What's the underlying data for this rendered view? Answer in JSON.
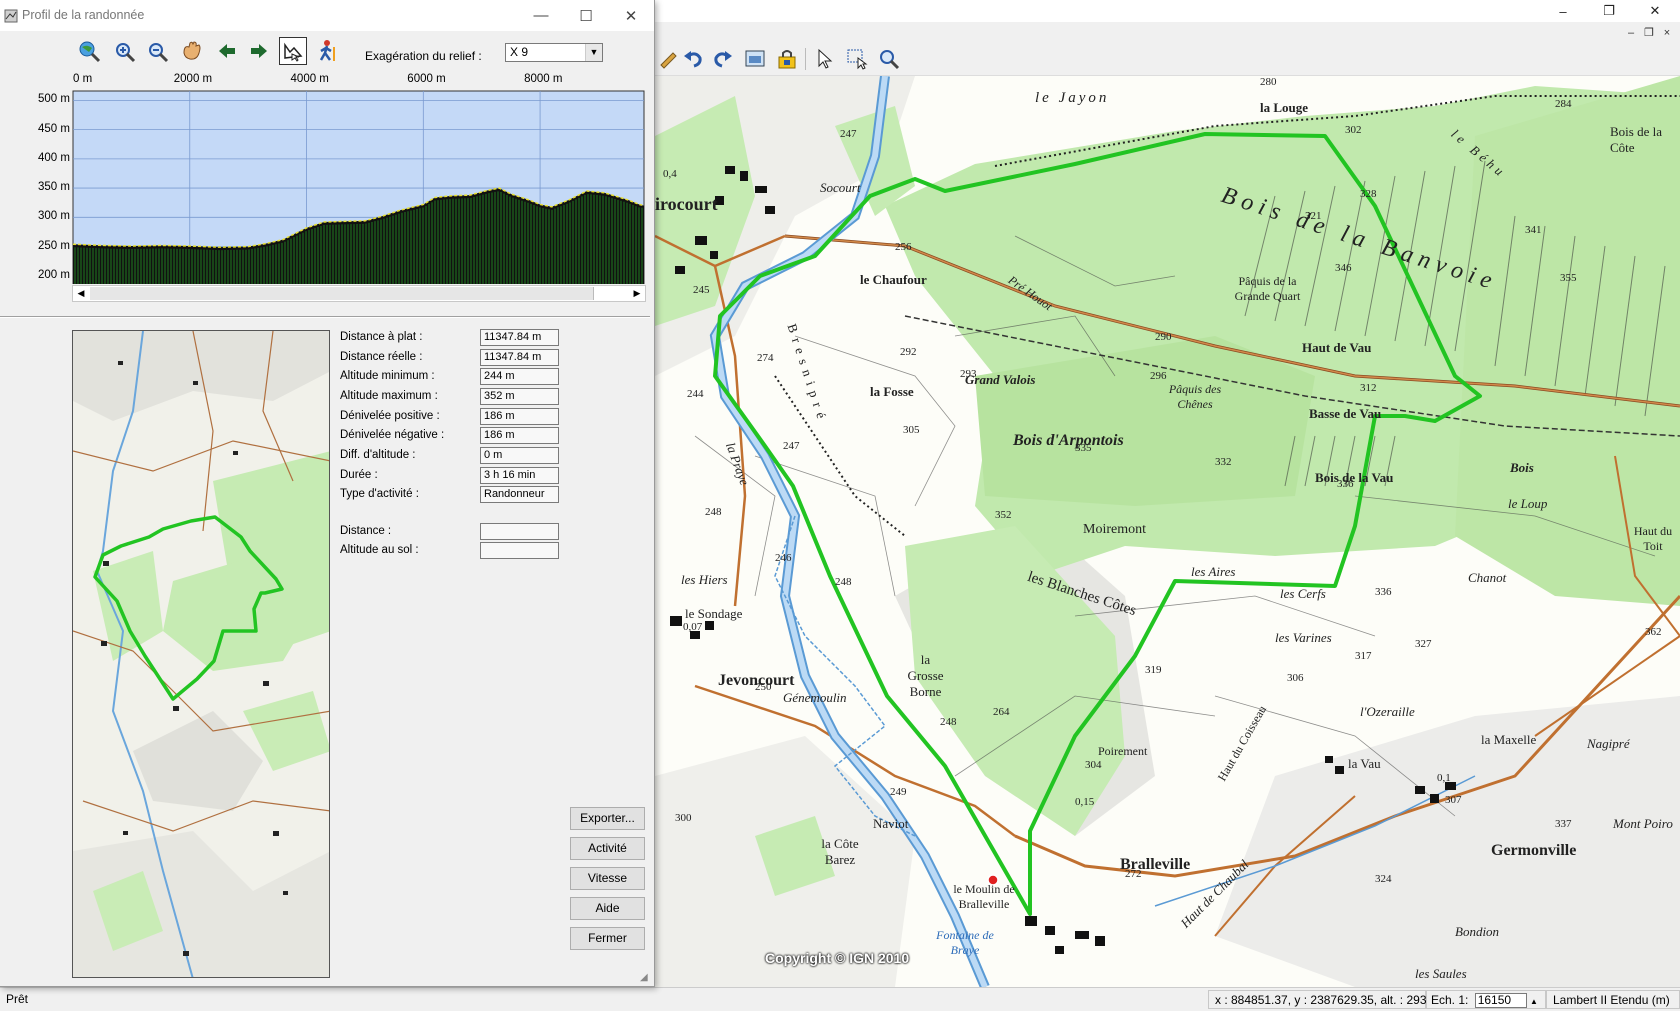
{
  "app": {
    "window_controls": {
      "minimize": "–",
      "restore": "❐",
      "close": "✕"
    },
    "mdi_controls": {
      "minimize": "–",
      "restore": "❐",
      "close": "×"
    }
  },
  "dialog": {
    "title": "Profil de la randonnée",
    "controls": {
      "minimize": "—",
      "maximize": "☐",
      "close": "✕"
    },
    "toolbar_icons": [
      "zoom-globe-icon",
      "zoom-in-icon",
      "zoom-out-icon",
      "pan-hand-icon",
      "arrow-left-icon",
      "arrow-right-icon",
      "profile-view-icon",
      "hiker-icon"
    ],
    "relief_label": "Exagération du relief :",
    "relief_value": "X 9",
    "profile": {
      "x_ticks": [
        "0 m",
        "2000 m",
        "4000 m",
        "6000 m",
        "8000 m"
      ],
      "y_ticks": [
        "500 m",
        "450 m",
        "400 m",
        "350 m",
        "300 m",
        "250 m",
        "200 m"
      ],
      "sky_color": "#c4d9f7",
      "terrain_color": "#1e7a1e",
      "elevation_points": [
        [
          0,
          254
        ],
        [
          500,
          252
        ],
        [
          1000,
          251
        ],
        [
          1500,
          252
        ],
        [
          2000,
          251
        ],
        [
          2500,
          249
        ],
        [
          3000,
          250
        ],
        [
          3300,
          255
        ],
        [
          3600,
          262
        ],
        [
          4000,
          282
        ],
        [
          4300,
          292
        ],
        [
          4600,
          293
        ],
        [
          5000,
          294
        ],
        [
          5300,
          302
        ],
        [
          5600,
          312
        ],
        [
          6000,
          322
        ],
        [
          6200,
          334
        ],
        [
          6500,
          337
        ],
        [
          6800,
          338
        ],
        [
          7100,
          346
        ],
        [
          7300,
          350
        ],
        [
          7500,
          340
        ],
        [
          7800,
          330
        ],
        [
          8000,
          322
        ],
        [
          8200,
          318
        ],
        [
          8500,
          330
        ],
        [
          8800,
          345
        ],
        [
          9100,
          342
        ],
        [
          9300,
          336
        ],
        [
          9500,
          330
        ],
        [
          9700,
          322
        ],
        [
          10000,
          320
        ],
        [
          10300,
          325
        ],
        [
          10600,
          332
        ],
        [
          10900,
          322
        ],
        [
          11347,
          316
        ]
      ]
    },
    "stats": [
      {
        "label": "Distance à plat :",
        "value": "11347.84 m"
      },
      {
        "label": "Distance réelle :",
        "value": "11347.84 m"
      },
      {
        "label": "Altitude minimum :",
        "value": "244 m"
      },
      {
        "label": "Altitude maximum :",
        "value": "352 m"
      },
      {
        "label": "Dénivelée positive :",
        "value": "186 m"
      },
      {
        "label": "Dénivelée négative :",
        "value": "186 m"
      },
      {
        "label": "Diff. d'altitude :",
        "value": "0 m"
      },
      {
        "label": "Durée :",
        "value": "3 h 16 min"
      },
      {
        "label": "Type d'activité :",
        "value": "Randonneur"
      }
    ],
    "cursor_stats": [
      {
        "label": "Distance :",
        "value": ""
      },
      {
        "label": "Altitude au sol :",
        "value": ""
      }
    ],
    "buttons": {
      "export": "Exporter...",
      "activity": "Activité",
      "speed": "Vitesse",
      "help": "Aide",
      "close": "Fermer"
    }
  },
  "map": {
    "copyright": "Copyright © IGN 2010",
    "route_color": "#22c422",
    "forest_color": "#bfe8a8",
    "labels": {
      "bois_banvoie": "Bois de la Banvoie",
      "le_jayon": "le Jayon",
      "la_louge": "la Louge",
      "le_behu": "le Béhu",
      "bois_cote": "Bois de la Côte",
      "socourt": "Socourt",
      "virocourt": "irocourt",
      "le_chaufour": "le Chaufour",
      "paquis_grande": "Pâquis de la Grande Quart",
      "haut_de_vau": "Haut de Vau",
      "la_fosse": "la Fosse",
      "grand_valois": "Grand Valois",
      "pre_houot": "Pré Houot",
      "paquis_chenes": "Pâquis des Chênes",
      "basse_de_vau": "Basse de Vau",
      "bois_arpontois": "Bois d'Arpontois",
      "bois_la_vau": "Bois de la Vau",
      "bois": "Bois",
      "le_loup": "le Loup",
      "moiremont": "Moiremont",
      "les_aires": "les Aires",
      "les_cerfs": "les Cerfs",
      "les_blanches": "les Blanches Côtes",
      "chanot": "Chanot",
      "les_hiers": "les Hiers",
      "le_sondage": "le Sondage",
      "jevoncourt": "Jevoncourt",
      "genemoulin": "Génemoulin",
      "la_grosse_borne": "la Grosse Borne",
      "les_varines": "les Varines",
      "l_ozeraille": "l'Ozeraille",
      "la_maxelle": "la Maxelle",
      "nagipre": "Nagipré",
      "poirement": "Poirement",
      "haut_coisseau": "Haut du Coisseau",
      "la_vau": "la Vau",
      "naviot": "Naviot",
      "bralleville": "Bralleville",
      "germonville": "Germonville",
      "mont_poiro": "Mont Poiro",
      "le_moulin": "le Moulin de Bralleville",
      "fontaine": "Fontaine de Braye",
      "haut_chaubal": "Haut de Chaubal",
      "bondion": "Bondion",
      "les_saules": "les Saules",
      "la_cote_barez": "la Côte Barez",
      "haut_du_toit": "Haut du Toit",
      "la_praye": "la Praye",
      "bresnipre": "Bresnipré"
    },
    "spot_heights": [
      "280",
      "302",
      "328",
      "284",
      "247",
      "256",
      "245",
      "292",
      "290",
      "312",
      "274",
      "293",
      "296",
      "305",
      "335",
      "332",
      "336",
      "321",
      "346",
      "355",
      "341",
      "244",
      "247",
      "248",
      "246",
      "248",
      "352",
      "336",
      "319",
      "304",
      "306",
      "317",
      "327",
      "307",
      "264",
      "248",
      "249",
      "250",
      "300",
      "272",
      "324",
      "337",
      "362",
      "0,07",
      "0,15",
      "0,1",
      "0,4"
    ]
  },
  "statusbar": {
    "ready": "Prêt",
    "coords": "x : 884851.37, y : 2387629.35, alt. : 293 m",
    "scale_label": "Ech. 1:",
    "scale_value": "16150",
    "projection": "Lambert II Etendu (m)"
  }
}
